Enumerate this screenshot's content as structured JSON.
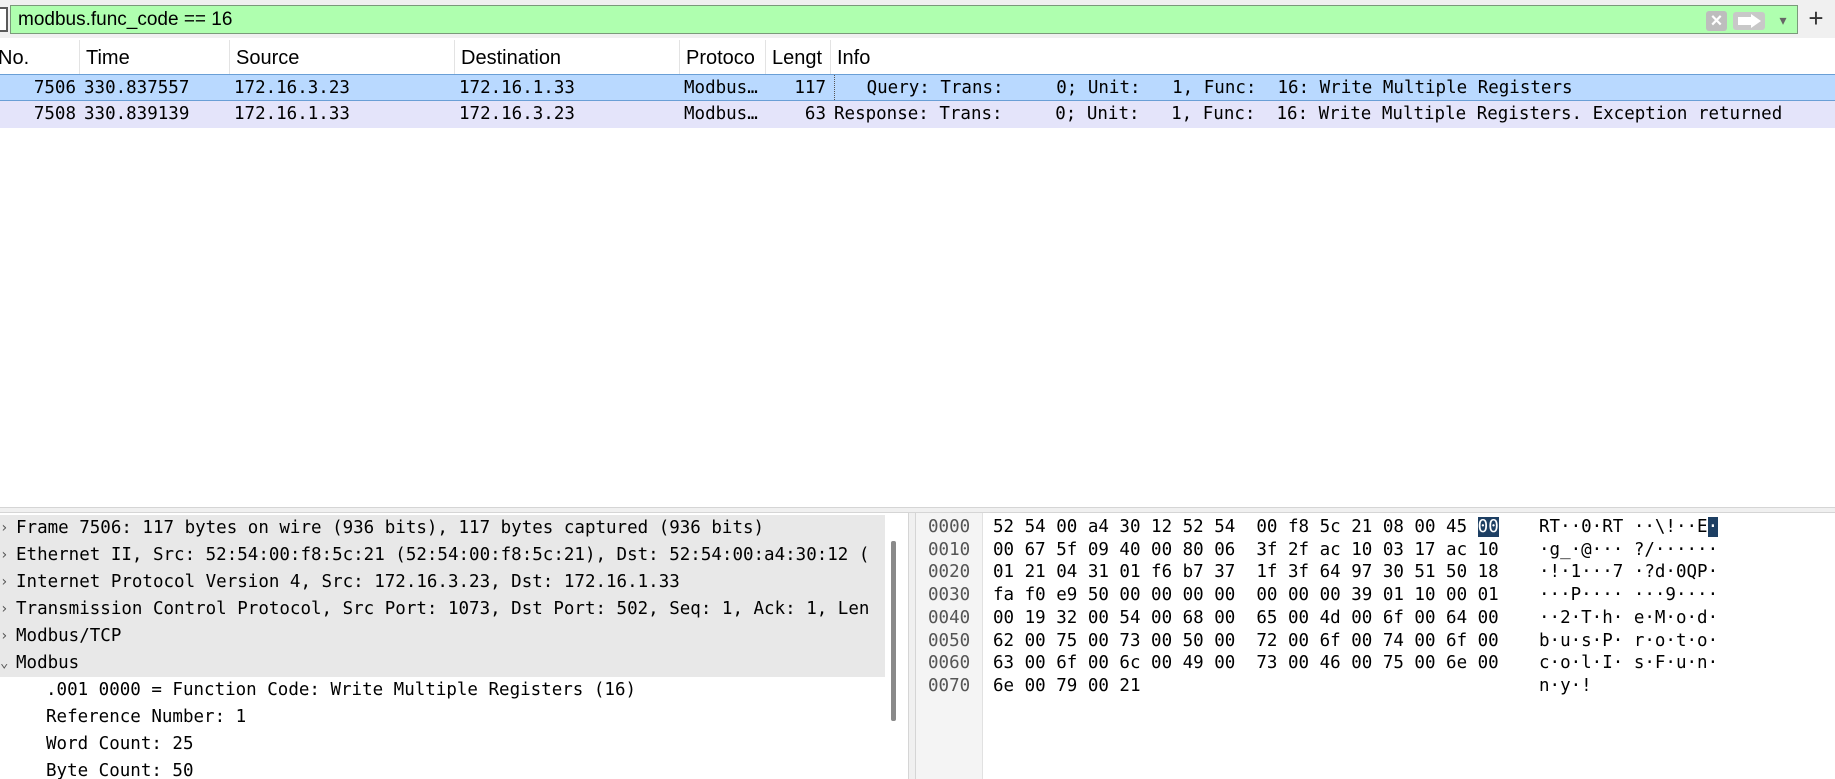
{
  "filter": {
    "expression": "modbus.func_code == 16",
    "clear_icon": "x-icon",
    "apply_icon": "arrow-right-icon",
    "history_icon": "chevron-down-icon",
    "add_label": "+"
  },
  "packet_list": {
    "columns": [
      "No.",
      "Time",
      "Source",
      "Destination",
      "Protoco",
      "Lengt",
      "Info"
    ],
    "rows": [
      {
        "no": "7506",
        "time": "330.837557",
        "source": "172.16.3.23",
        "destination": "172.16.1.33",
        "protocol": "Modbus…",
        "length": "117",
        "info": "   Query: Trans:     0; Unit:   1, Func:  16: Write Multiple Registers",
        "selected": true
      },
      {
        "no": "7508",
        "time": "330.839139",
        "source": "172.16.1.33",
        "destination": "172.16.3.23",
        "protocol": "Modbus…",
        "length": "63",
        "info": "Response: Trans:     0; Unit:   1, Func:  16: Write Multiple Registers. Exception returned",
        "selected": false
      }
    ]
  },
  "details": {
    "rows": [
      {
        "arrow": "›",
        "text": "Frame 7506: 117 bytes on wire (936 bits), 117 bytes captured (936 bits)",
        "indent": 0,
        "highlight": true
      },
      {
        "arrow": "›",
        "text": "Ethernet II, Src: 52:54:00:f8:5c:21 (52:54:00:f8:5c:21), Dst: 52:54:00:a4:30:12 (",
        "indent": 0,
        "highlight": true
      },
      {
        "arrow": "›",
        "text": "Internet Protocol Version 4, Src: 172.16.3.23, Dst: 172.16.1.33",
        "indent": 0,
        "highlight": true
      },
      {
        "arrow": "›",
        "text": "Transmission Control Protocol, Src Port: 1073, Dst Port: 502, Seq: 1, Ack: 1, Len",
        "indent": 0,
        "highlight": true
      },
      {
        "arrow": "›",
        "text": "Modbus/TCP",
        "indent": 0,
        "highlight": true
      },
      {
        "arrow": "⌄",
        "text": "Modbus",
        "indent": 0,
        "highlight": true
      },
      {
        "arrow": "",
        "text": ".001 0000 = Function Code: Write Multiple Registers (16)",
        "indent": 1,
        "highlight": false
      },
      {
        "arrow": "",
        "text": "Reference Number: 1",
        "indent": 1,
        "highlight": false
      },
      {
        "arrow": "",
        "text": "Word Count: 25",
        "indent": 1,
        "highlight": false
      },
      {
        "arrow": "",
        "text": "Byte Count: 50",
        "indent": 1,
        "highlight": false
      }
    ]
  },
  "bytes": {
    "rows": [
      {
        "offset": "0000",
        "hex_before": "52 54 00 a4 30 12 52 54  00 f8 5c 21 08 00 45 ",
        "hex_hl": "00",
        "ascii_before": "RT··0·RT ··\\!··E",
        "ascii_hl": "·"
      },
      {
        "offset": "0010",
        "hex_before": "00 67 5f 09 40 00 80 06  3f 2f ac 10 03 17 ac 10",
        "hex_hl": "",
        "ascii_before": "·g_·@··· ?/······",
        "ascii_hl": ""
      },
      {
        "offset": "0020",
        "hex_before": "01 21 04 31 01 f6 b7 37  1f 3f 64 97 30 51 50 18",
        "hex_hl": "",
        "ascii_before": "·!·1···7 ·?d·0QP·",
        "ascii_hl": ""
      },
      {
        "offset": "0030",
        "hex_before": "fa f0 e9 50 00 00 00 00  00 00 00 39 01 10 00 01",
        "hex_hl": "",
        "ascii_before": "···P···· ···9····",
        "ascii_hl": ""
      },
      {
        "offset": "0040",
        "hex_before": "00 19 32 00 54 00 68 00  65 00 4d 00 6f 00 64 00",
        "hex_hl": "",
        "ascii_before": "··2·T·h· e·M·o·d·",
        "ascii_hl": ""
      },
      {
        "offset": "0050",
        "hex_before": "62 00 75 00 73 00 50 00  72 00 6f 00 74 00 6f 00",
        "hex_hl": "",
        "ascii_before": "b·u·s·P· r·o·t·o·",
        "ascii_hl": ""
      },
      {
        "offset": "0060",
        "hex_before": "63 00 6f 00 6c 00 49 00  73 00 46 00 75 00 6e 00",
        "hex_hl": "",
        "ascii_before": "c·o·l·I· s·F·u·n·",
        "ascii_hl": ""
      },
      {
        "offset": "0070",
        "hex_before": "6e 00 79 00 21",
        "hex_hl": "",
        "ascii_before": "n·y·!",
        "ascii_hl": ""
      }
    ]
  },
  "colors": {
    "filter_valid_bg": "#afffaf",
    "selected_row_bg": "#b9d9ff",
    "alt_row_bg": "#e4e4fa",
    "byte_highlight_bg": "#1d3f63"
  }
}
